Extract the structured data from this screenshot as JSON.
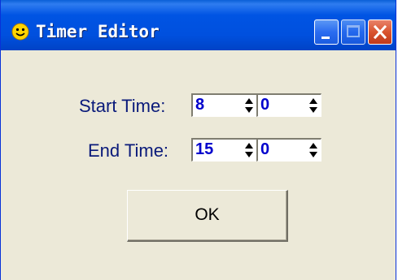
{
  "window": {
    "title": "Timer Editor",
    "icon": "smiley-icon",
    "controls": {
      "minimize": "minimize-icon",
      "maximize": "maximize-icon",
      "close": "close-icon"
    }
  },
  "form": {
    "start_label": "Start Time:",
    "end_label": "End Time:",
    "start_hour": "8",
    "start_minute": "0",
    "end_hour": "15",
    "end_minute": "0",
    "ok_label": "OK"
  },
  "colors": {
    "titlebar": "#0054e3",
    "label_text": "#0a1a7a",
    "spin_value": "#0000cc",
    "dialog_bg": "#ece9d8",
    "close_button": "#d9542f"
  }
}
